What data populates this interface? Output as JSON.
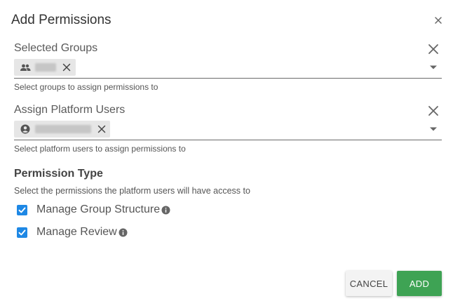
{
  "dialog": {
    "title": "Add Permissions",
    "close_icon": "close-icon"
  },
  "selected_groups": {
    "label": "Selected Groups",
    "chip_icon": "group-icon",
    "helper": "Select groups to assign permissions to"
  },
  "platform_users": {
    "label": "Assign Platform Users",
    "chip_icon": "user-circle-icon",
    "helper": "Select platform users to assign permissions to"
  },
  "permission_type": {
    "title": "Permission Type",
    "subtitle": "Select the permissions the platform users will have access to",
    "options": [
      {
        "label": "Manage Group Structure",
        "checked": true
      },
      {
        "label": "Manage Review",
        "checked": true
      }
    ]
  },
  "actions": {
    "cancel_label": "CANCEL",
    "add_label": "ADD"
  },
  "colors": {
    "checkbox": "#1e88e5",
    "add_button": "#3ea354"
  }
}
